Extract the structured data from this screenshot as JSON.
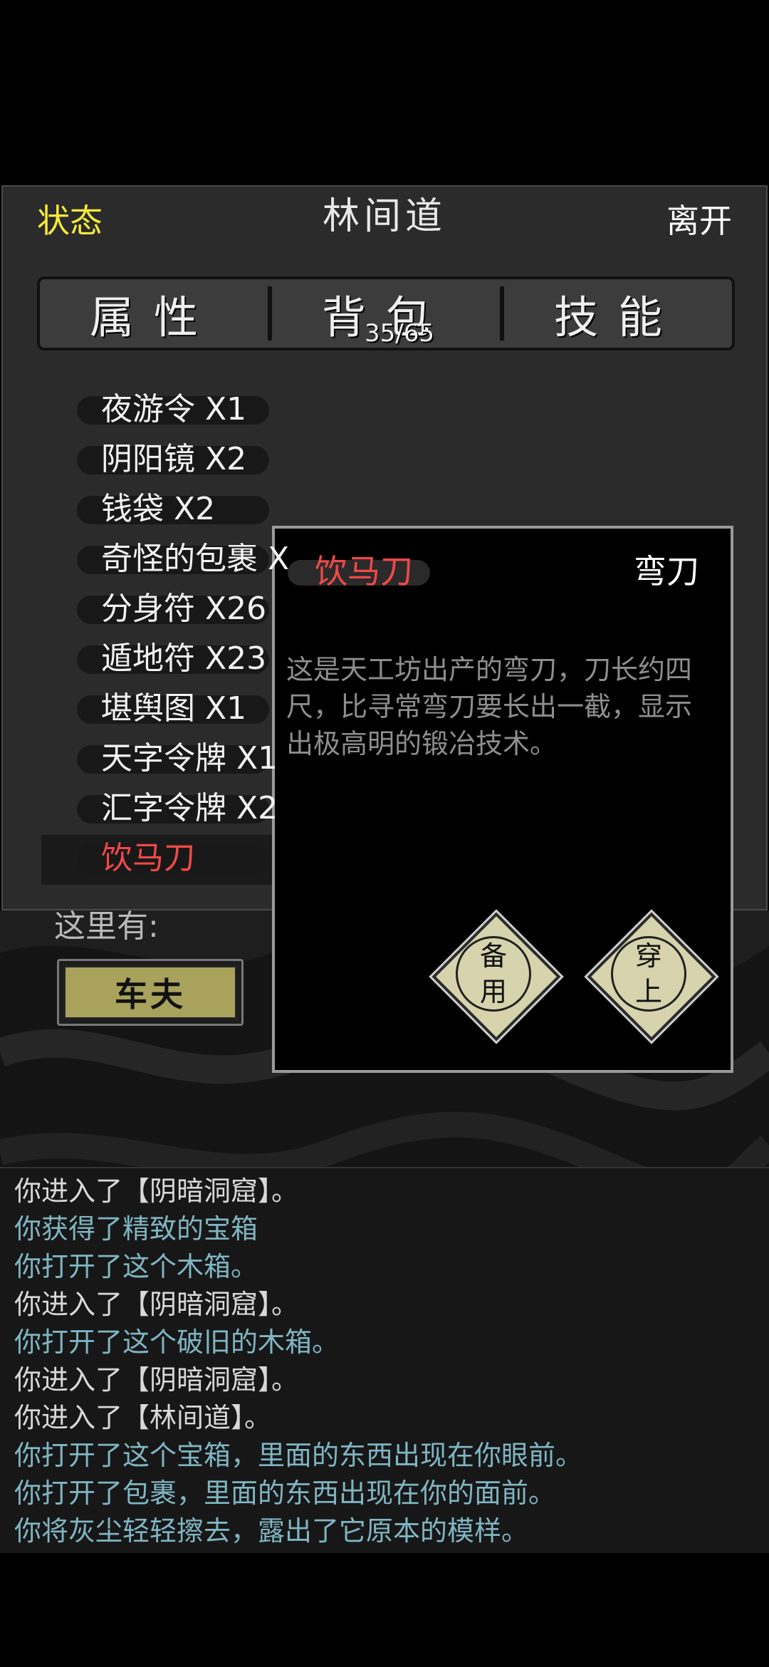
{
  "header": {
    "status_label": "状态",
    "location_title": "林间道",
    "leave_label": "离开"
  },
  "tabs": {
    "attributes": "属性",
    "backpack": "背包",
    "backpack_count": "35/65",
    "skills": "技能"
  },
  "inventory": [
    "夜游令 X1",
    "阴阳镜 X2",
    "钱袋 X2",
    "奇怪的包裹 X",
    "分身符 X26",
    "遁地符 X23",
    "堪舆图 X1",
    "天字令牌 X1",
    "汇字令牌 X2",
    "饮马刀"
  ],
  "here": {
    "label": "这里有:",
    "npc": "车夫"
  },
  "item_detail": {
    "name": "饮马刀",
    "type": "弯刀",
    "description": "这是天工坊出产的弯刀，刀长约四尺，比寻常弯刀要长出一截，显示出极高明的锻冶技术。",
    "action_reserve": [
      "备",
      "用"
    ],
    "action_equip": [
      "穿",
      "上"
    ]
  },
  "log": [
    {
      "text": "你进入了【阴暗洞窟】。",
      "color": "white"
    },
    {
      "text": "你获得了精致的宝箱",
      "color": "teal"
    },
    {
      "text": "你打开了这个木箱。",
      "color": "teal"
    },
    {
      "text": "你进入了【阴暗洞窟】。",
      "color": "white"
    },
    {
      "text": "你打开了这个破旧的木箱。",
      "color": "teal"
    },
    {
      "text": "你进入了【阴暗洞窟】。",
      "color": "white"
    },
    {
      "text": "你进入了【林间道】。",
      "color": "white"
    },
    {
      "text": "你打开了这个宝箱，里面的东西出现在你眼前。",
      "color": "teal"
    },
    {
      "text": "你打开了包裹，里面的东西出现在你的面前。",
      "color": "teal"
    },
    {
      "text": "你将灰尘轻轻擦去，露出了它原本的模样。",
      "color": "teal"
    }
  ],
  "colors": {
    "status_yellow": "#f4ea3a",
    "selected_red": "#ef4848",
    "log_teal": "#7fb5c2"
  }
}
